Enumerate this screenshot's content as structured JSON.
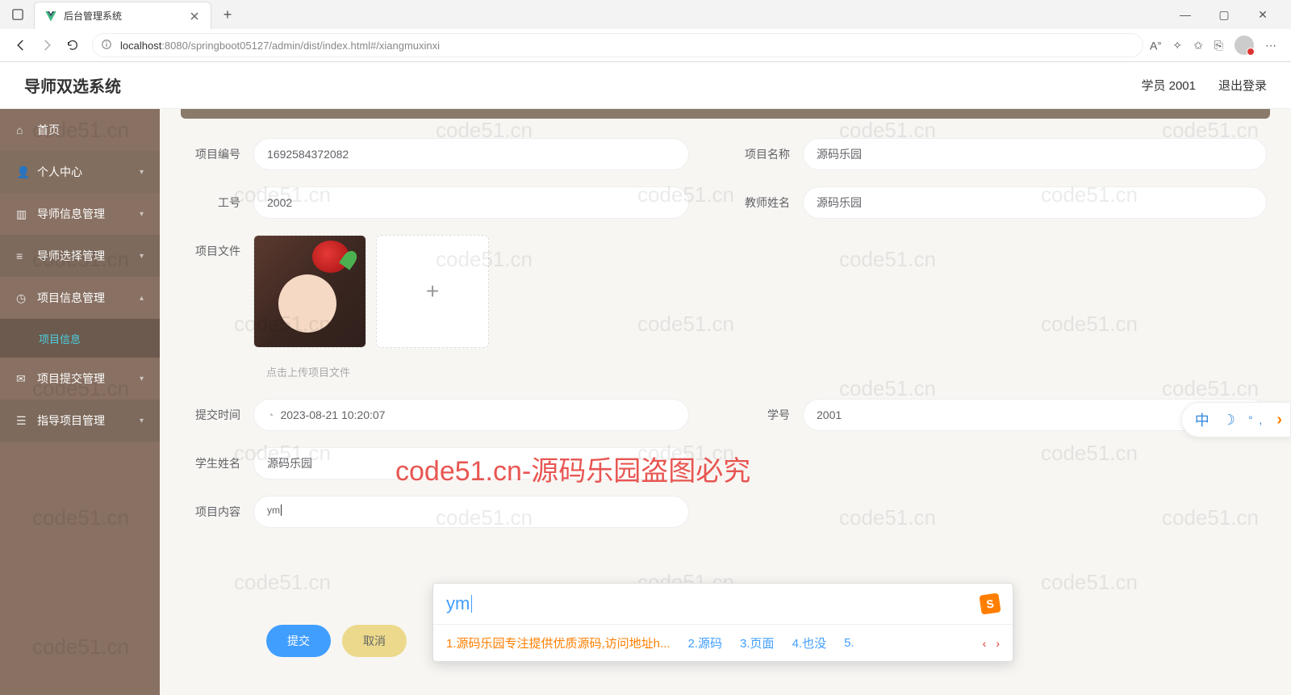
{
  "browser": {
    "tab_title": "后台管理系统",
    "url_host": "localhost",
    "url_rest": ":8080/springboot05127/admin/dist/index.html#/xiangmuxinxi"
  },
  "app": {
    "title": "导师双选系统",
    "user_label": "学员 2001",
    "logout": "退出登录"
  },
  "sidebar": {
    "home": "首页",
    "personal": "个人中心",
    "tutor_info": "导师信息管理",
    "tutor_select": "导师选择管理",
    "project_info": "项目信息管理",
    "project_info_sub": "项目信息",
    "project_submit": "项目提交管理",
    "guide_project": "指导项目管理"
  },
  "form": {
    "project_no_label": "项目编号",
    "project_no_value": "1692584372082",
    "project_name_label": "项目名称",
    "project_name_value": "源码乐园",
    "job_no_label": "工号",
    "job_no_value": "2002",
    "teacher_label": "教师姓名",
    "teacher_value": "源码乐园",
    "file_label": "项目文件",
    "upload_tip": "点击上传项目文件",
    "submit_time_label": "提交时间",
    "submit_time_value": "2023-08-21 10:20:07",
    "student_id_label": "学号",
    "student_id_value": "2001",
    "student_name_label": "学生姓名",
    "student_name_value": "源码乐园",
    "content_label": "项目内容",
    "content_value": "ym",
    "submit_btn": "提交",
    "cancel_btn": "取消"
  },
  "ime": {
    "composition": "ym",
    "logo": "S",
    "candidates": [
      "1.源码乐园专注提供优质源码,访问地址h...",
      "2.源码",
      "3.页面",
      "4.也没",
      "5."
    ]
  },
  "watermark": {
    "small": "code51.cn",
    "big": "code51.cn-源码乐园盗图必究"
  },
  "side_float": {
    "lang": "中"
  }
}
